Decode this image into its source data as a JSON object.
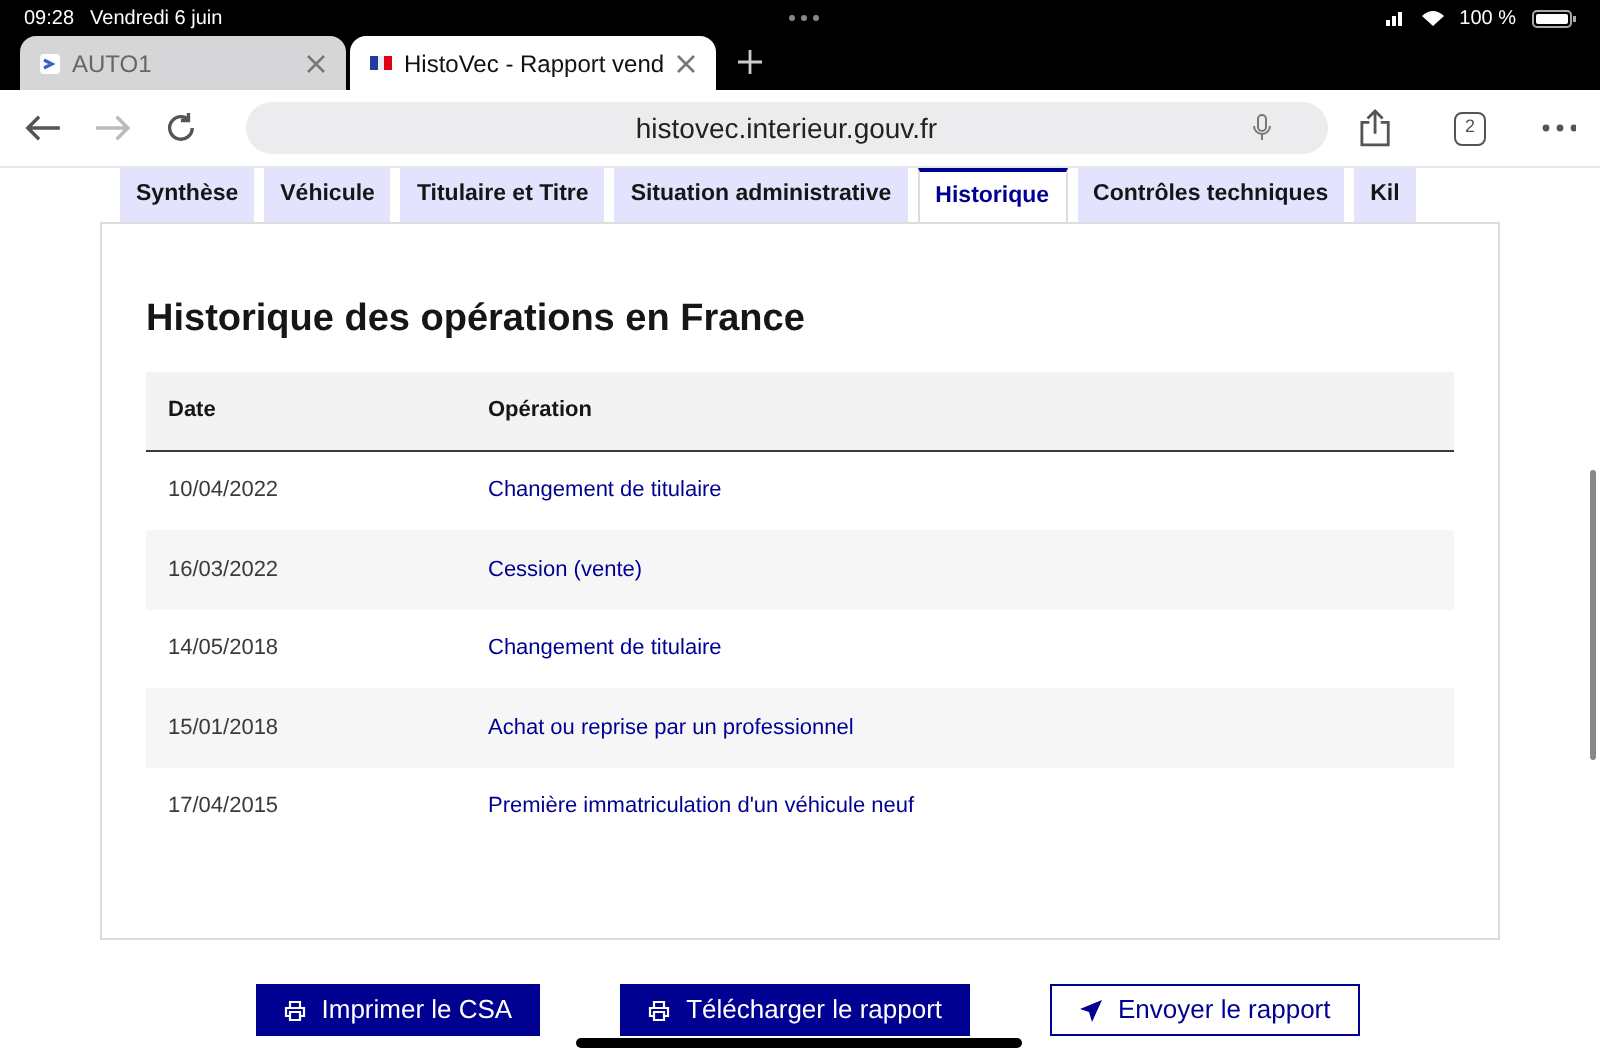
{
  "status_bar": {
    "time": "09:28",
    "date": "Vendredi 6 juin",
    "battery": "100 %"
  },
  "browser_tabs": [
    {
      "title": "AUTO1",
      "selected": false
    },
    {
      "title": "HistoVec - Rapport vend",
      "selected": true
    }
  ],
  "address_bar": {
    "url": "histovec.interieur.gouv.fr",
    "tab_count": "2"
  },
  "page_tabs": [
    {
      "label": "Synthèse",
      "selected": false
    },
    {
      "label": "Véhicule",
      "selected": false
    },
    {
      "label": "Titulaire et Titre",
      "selected": false
    },
    {
      "label": "Situation administrative",
      "selected": false
    },
    {
      "label": "Historique",
      "selected": true
    },
    {
      "label": "Contrôles techniques",
      "selected": false
    },
    {
      "label": "Kil",
      "selected": false
    }
  ],
  "section": {
    "title": "Historique des opérations en France",
    "table": {
      "columns": [
        "Date",
        "Opération"
      ],
      "rows": [
        [
          "10/04/2022",
          "Changement de titulaire"
        ],
        [
          "16/03/2022",
          "Cession (vente)"
        ],
        [
          "14/05/2018",
          "Changement de titulaire"
        ],
        [
          "15/01/2018",
          "Achat ou reprise par un professionnel"
        ],
        [
          "17/04/2015",
          "Première immatriculation d'un véhicule neuf"
        ]
      ]
    }
  },
  "buttons": [
    {
      "label": "Imprimer le CSA",
      "kind": "primary"
    },
    {
      "label": "Télécharger le rapport",
      "kind": "primary"
    },
    {
      "label": "Envoyer le rapport",
      "kind": "secondary"
    }
  ]
}
